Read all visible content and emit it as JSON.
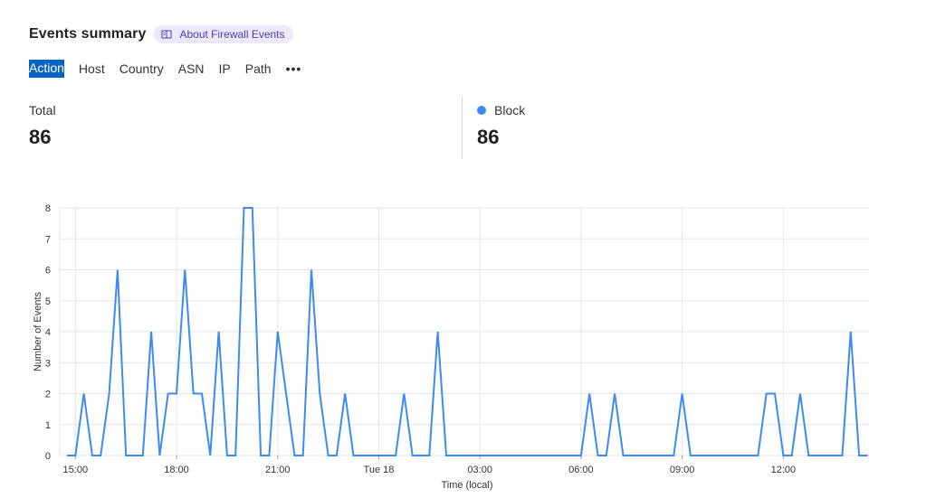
{
  "header": {
    "title": "Events summary",
    "about_label": "About Firewall Events"
  },
  "tabs": [
    {
      "label": "Action",
      "active": true
    },
    {
      "label": "Host"
    },
    {
      "label": "Country"
    },
    {
      "label": "ASN"
    },
    {
      "label": "IP"
    },
    {
      "label": "Path"
    }
  ],
  "more_label": "•••",
  "stats": {
    "total_label": "Total",
    "total_value": "86",
    "block_label": "Block",
    "block_value": "86",
    "block_color": "#3d8bf2"
  },
  "chart_data": {
    "type": "line",
    "xlabel": "Time (local)",
    "ylabel": "Number of Events",
    "ylim": [
      0,
      8
    ],
    "yticks": [
      "0",
      "1",
      "2",
      "3",
      "4",
      "5",
      "6",
      "7",
      "8"
    ],
    "xtick_labels": [
      "15:00",
      "18:00",
      "21:00",
      "Tue 18",
      "03:00",
      "06:00",
      "09:00",
      "12:00"
    ],
    "x_interval_minutes": 15,
    "x_start": "14:45",
    "grid": true,
    "series": [
      {
        "name": "Block",
        "color": "#3d8bf2",
        "values": [
          0,
          0,
          2,
          0,
          0,
          2,
          6,
          0,
          0,
          0,
          4,
          0,
          2,
          2,
          6,
          2,
          2,
          0,
          4,
          0,
          0,
          8,
          8,
          0,
          0,
          4,
          2,
          0,
          0,
          6,
          2,
          0,
          0,
          2,
          0,
          0,
          0,
          0,
          0,
          0,
          2,
          0,
          0,
          0,
          4,
          0,
          0,
          0,
          0,
          0,
          0,
          0,
          0,
          0,
          0,
          0,
          0,
          0,
          0,
          0,
          0,
          0,
          2,
          0,
          0,
          2,
          0,
          0,
          0,
          0,
          0,
          0,
          0,
          2,
          0,
          0,
          0,
          0,
          0,
          0,
          0,
          0,
          0,
          2,
          2,
          0,
          0,
          2,
          0,
          0,
          0,
          0,
          0,
          4,
          0,
          0
        ]
      }
    ]
  }
}
